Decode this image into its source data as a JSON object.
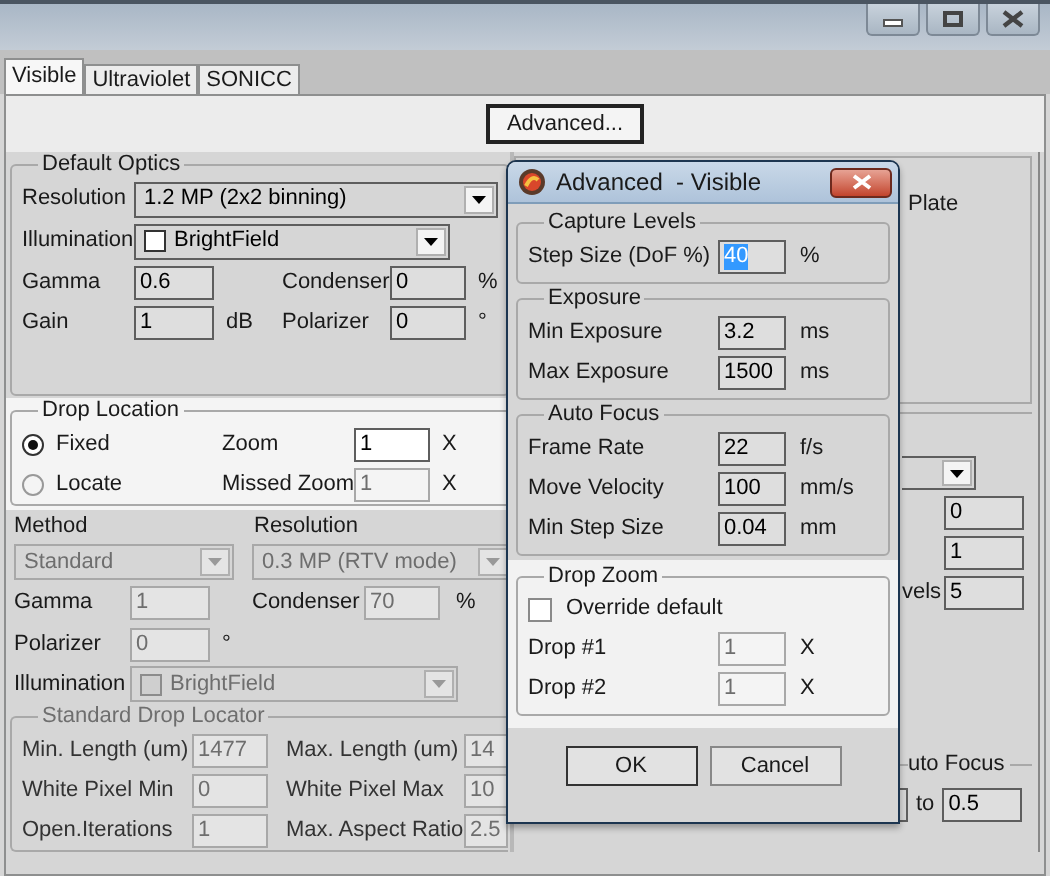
{
  "tabs": [
    {
      "label": "Visible",
      "selected": true
    },
    {
      "label": "Ultraviolet",
      "selected": false
    },
    {
      "label": "SONICC",
      "selected": false
    }
  ],
  "advanced_button": "Advanced...",
  "default_optics": {
    "title": "Default Optics",
    "resolution": {
      "label": "Resolution",
      "value": "1.2 MP (2x2 binning)"
    },
    "illumination": {
      "label": "Illumination",
      "value": "BrightField"
    },
    "gamma": {
      "label": "Gamma",
      "value": "0.6"
    },
    "condenser": {
      "label": "Condenser",
      "value": "0",
      "unit": "%"
    },
    "gain": {
      "label": "Gain",
      "value": "1",
      "unit": "dB"
    },
    "polarizer": {
      "label": "Polarizer",
      "value": "0",
      "unit": "°"
    }
  },
  "drop_location": {
    "title": "Drop Location",
    "modes": [
      {
        "label": "Fixed",
        "selected": true
      },
      {
        "label": "Locate",
        "selected": false
      }
    ],
    "zoom": {
      "label": "Zoom",
      "value": "1",
      "unit": "X",
      "disabled": false
    },
    "missed_zoom": {
      "label": "Missed Zoom",
      "value": "1",
      "unit": "X",
      "disabled": true
    }
  },
  "locate_settings": {
    "method": {
      "label": "Method",
      "value": "Standard",
      "disabled": true
    },
    "resolution": {
      "label": "Resolution",
      "value": "0.3 MP (RTV mode)",
      "disabled": true
    },
    "gamma": {
      "label": "Gamma",
      "value": "1",
      "disabled": true
    },
    "condenser": {
      "label": "Condenser",
      "value": "70",
      "unit": "%",
      "disabled": true
    },
    "polarizer": {
      "label": "Polarizer",
      "value": "0",
      "unit": "°",
      "disabled": true
    },
    "illumination": {
      "label": "Illumination",
      "value": "BrightField",
      "disabled": true
    }
  },
  "standard_drop_locator": {
    "title": "Standard Drop Locator",
    "disabled": true,
    "rows": [
      {
        "left": {
          "label": "Min. Length (um)",
          "value": "1477"
        },
        "right": {
          "label": "Max. Length (um)",
          "value": "14"
        }
      },
      {
        "left": {
          "label": "White Pixel Min",
          "value": "0"
        },
        "right": {
          "label": "White Pixel Max",
          "value": "10"
        }
      },
      {
        "left": {
          "label": "Open.Iterations",
          "value": "1"
        },
        "right": {
          "label": "Max. Aspect Ratio",
          "value": "2.5"
        }
      }
    ]
  },
  "right_panel": {
    "plate_label": "Plate",
    "field_1": "0",
    "field_2": "1",
    "levels_label": "vels",
    "levels_value": "5",
    "auto_focus_title": "uto Focus",
    "to_label": "to",
    "to_value": "0.5"
  },
  "dialog": {
    "title": "Advanced  - Visible",
    "groups": [
      {
        "title": "Capture Levels",
        "rows": [
          {
            "kind": "field",
            "label": "Step Size (DoF %)",
            "value": "40",
            "unit": "%",
            "disabled": false,
            "selected": true
          }
        ]
      },
      {
        "title": "Exposure",
        "rows": [
          {
            "kind": "field",
            "label": "Min Exposure",
            "value": "3.2",
            "unit": "ms",
            "disabled": false,
            "selected": false
          },
          {
            "kind": "field",
            "label": "Max Exposure",
            "value": "1500",
            "unit": "ms",
            "disabled": false,
            "selected": false
          }
        ]
      },
      {
        "title": "Auto Focus",
        "rows": [
          {
            "kind": "field",
            "label": "Frame Rate",
            "value": "22",
            "unit": "f/s",
            "disabled": false,
            "selected": false
          },
          {
            "kind": "field",
            "label": "Move Velocity",
            "value": "100",
            "unit": "mm/s",
            "disabled": false,
            "selected": false
          },
          {
            "kind": "field",
            "label": "Min Step Size",
            "value": "0.04",
            "unit": "mm",
            "disabled": false,
            "selected": false
          }
        ]
      },
      {
        "title": "Drop Zoom",
        "rows": [
          {
            "kind": "checkbox",
            "label": "Override default",
            "checked": false
          },
          {
            "kind": "field",
            "label": "Drop #1",
            "value": "1",
            "unit": "X",
            "disabled": true,
            "selected": false
          },
          {
            "kind": "field",
            "label": "Drop #2",
            "value": "1",
            "unit": "X",
            "disabled": true,
            "selected": false
          }
        ]
      }
    ],
    "buttons": [
      "OK",
      "Cancel"
    ]
  }
}
